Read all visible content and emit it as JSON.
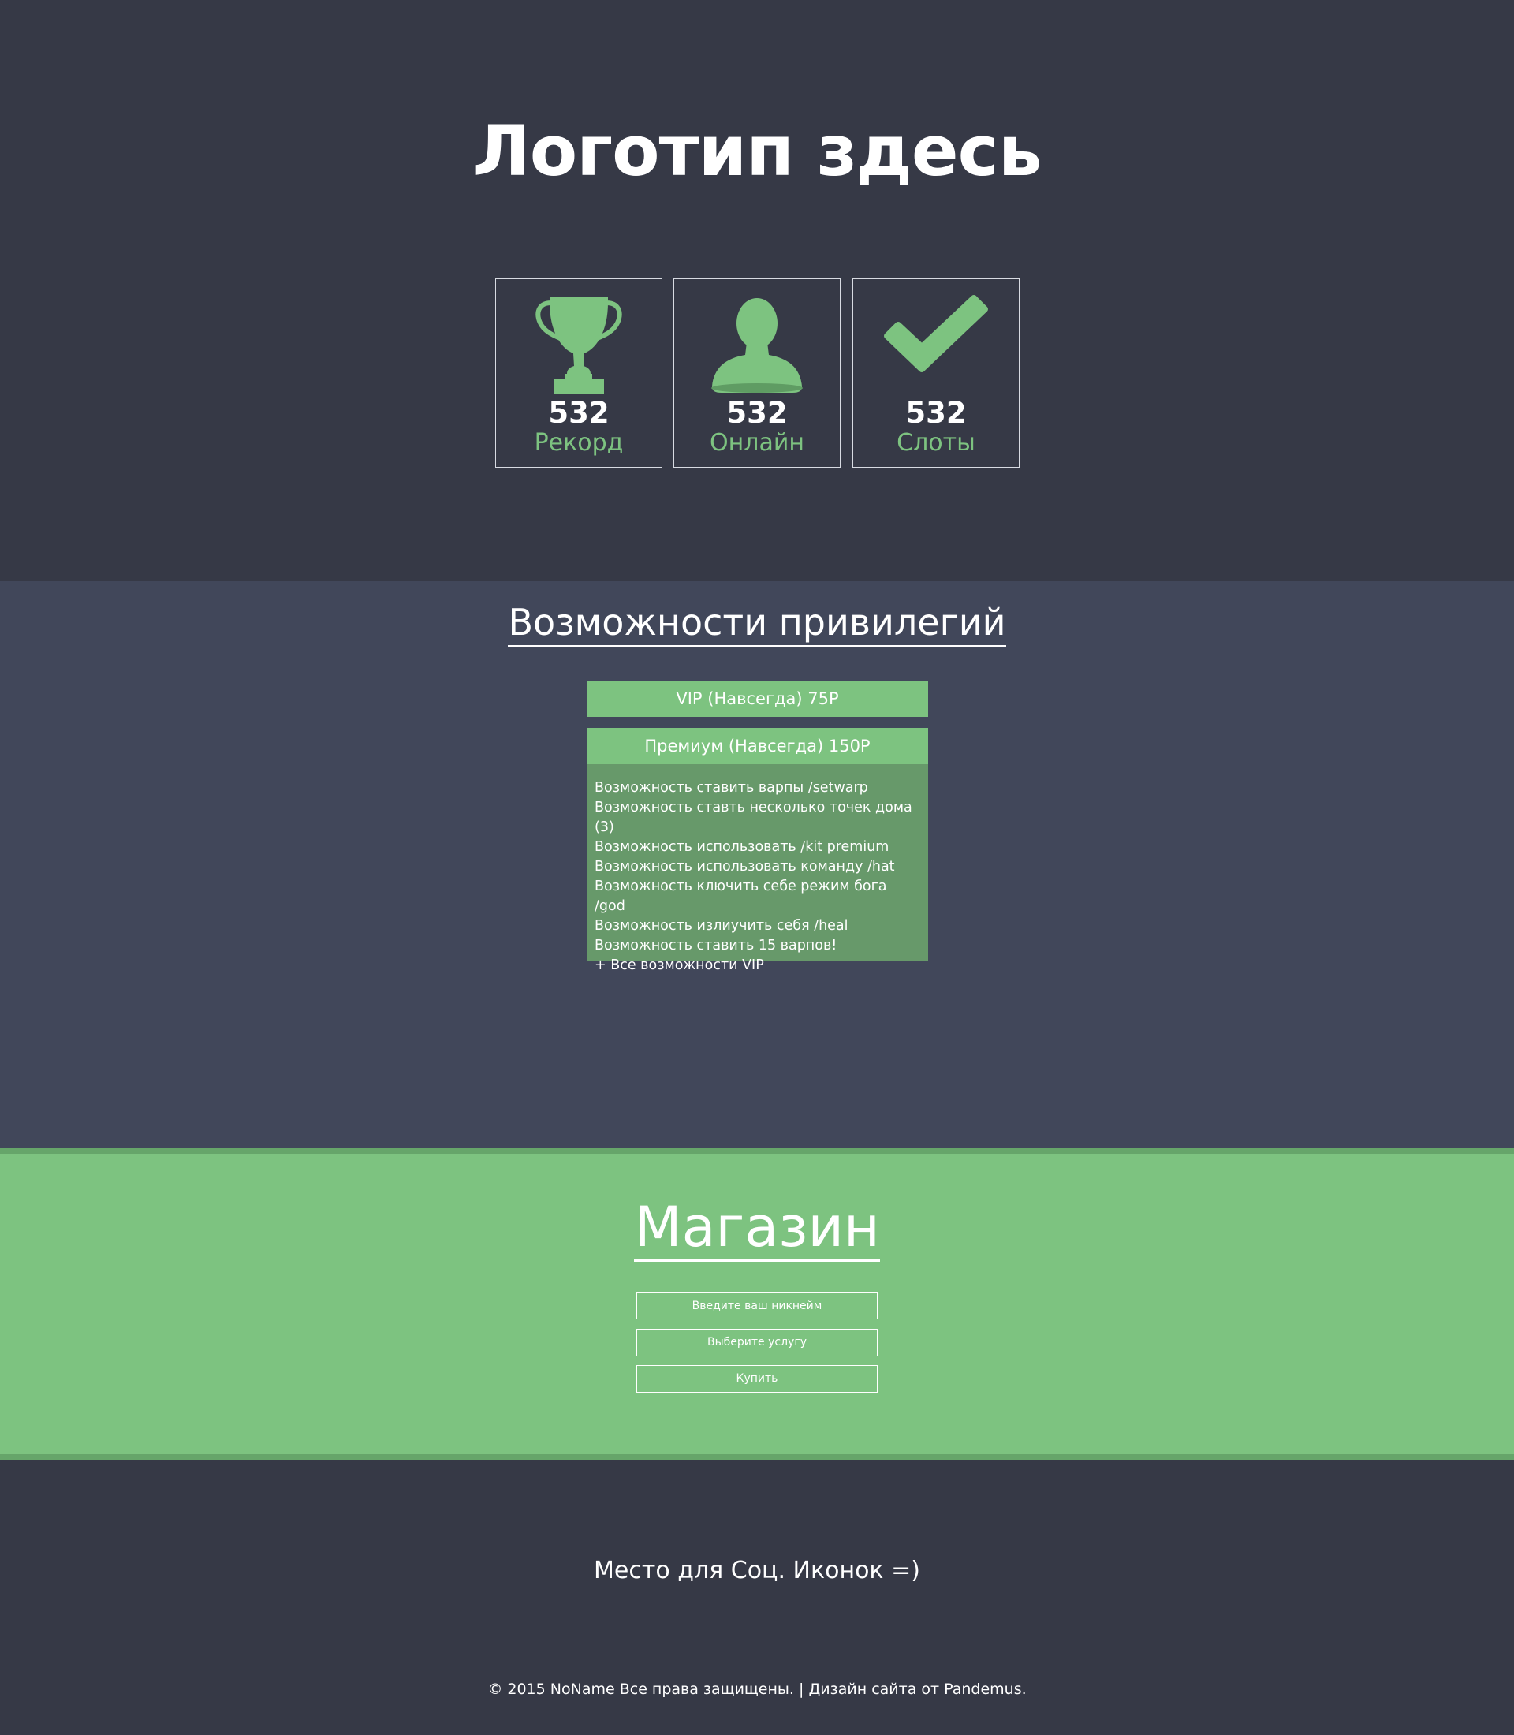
{
  "header": {
    "logo": "Логотип здесь",
    "stats": [
      {
        "icon": "trophy-icon",
        "value": "532",
        "label": "Рекорд"
      },
      {
        "icon": "user-icon",
        "value": "532",
        "label": "Онлайн"
      },
      {
        "icon": "checkmark-icon",
        "value": "532",
        "label": "Слоты"
      }
    ]
  },
  "features": {
    "title": "Возможности привилегий",
    "privileges": [
      {
        "label": "VIP (Навсегда) 75Р"
      },
      {
        "label": "Премиум (Навсегда) 150Р"
      }
    ],
    "premium_items": [
      "Возможность ставить варпы /setwarp",
      "Возможность ставть несколько точек дома (3)",
      "Возможность использовать  /kit premium",
      "Возможность использовать команду /hat",
      "Возможность ключить себе режим бога /god",
      "Возможность излиучить себя /heal",
      "Возможность ставить 15 варпов!",
      "+ Все возможности VIP"
    ]
  },
  "shop": {
    "title": "Магазин",
    "nickname_placeholder": "Введите ваш никнейм",
    "service_label": "Выберите услугу",
    "buy_label": "Купить"
  },
  "footer": {
    "social": "Место для Соц. Иконок =)",
    "copyright": "© 2015 NoName Все права защищены. | Дизайн сайта от Pandemus."
  },
  "colors": {
    "dark_bg": "#363946",
    "mid_bg": "#41475a",
    "accent_green": "#7dc380",
    "dark_green": "#67996a"
  }
}
